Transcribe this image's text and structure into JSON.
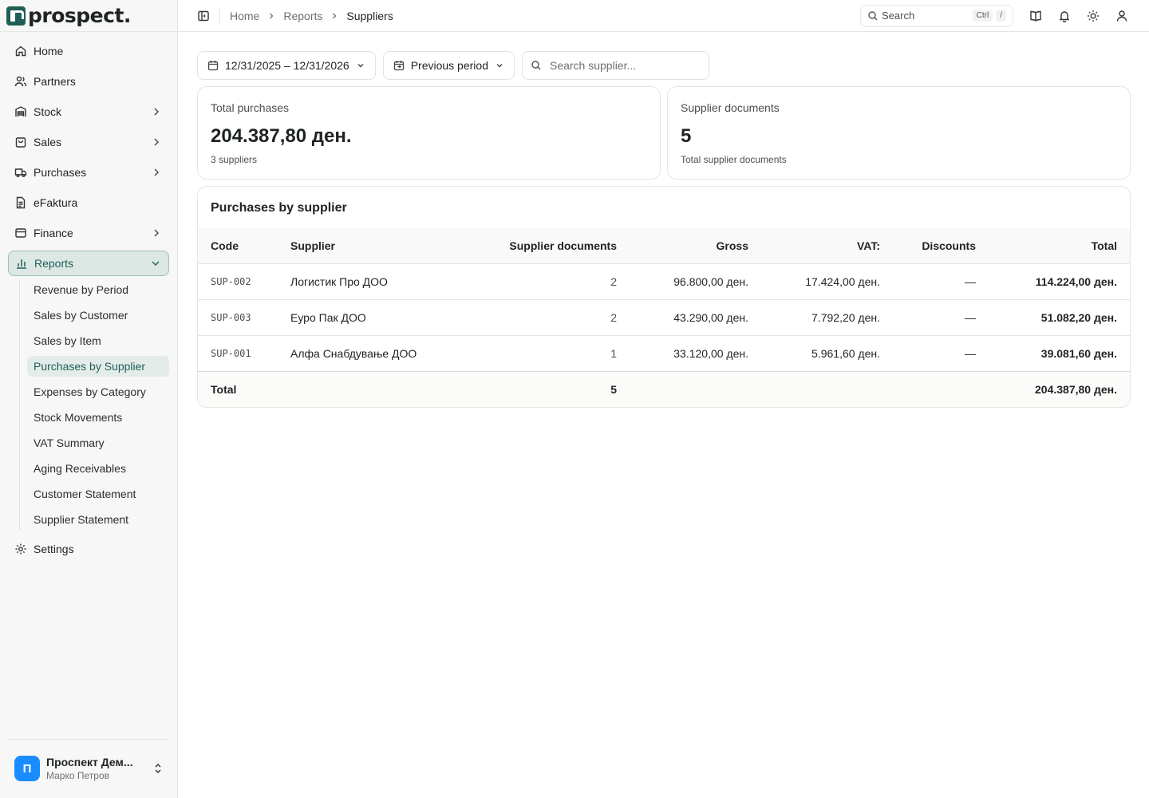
{
  "brand": {
    "name": "prospect."
  },
  "sidebar": {
    "items": [
      {
        "label": "Home",
        "icon": "home-icon"
      },
      {
        "label": "Partners",
        "icon": "users-icon"
      },
      {
        "label": "Stock",
        "icon": "warehouse-icon"
      },
      {
        "label": "Sales",
        "icon": "shopping-bag-icon"
      },
      {
        "label": "Purchases",
        "icon": "truck-icon"
      },
      {
        "label": "eFaktura",
        "icon": "document-icon"
      },
      {
        "label": "Finance",
        "icon": "wallet-icon"
      },
      {
        "label": "Reports",
        "icon": "bar-chart-icon"
      },
      {
        "label": "Settings",
        "icon": "gear-icon"
      }
    ],
    "reports_sub": [
      "Revenue by Period",
      "Sales by Customer",
      "Sales by Item",
      "Purchases by Supplier",
      "Expenses by Category",
      "Stock Movements",
      "VAT Summary",
      "Aging Receivables",
      "Customer Statement",
      "Supplier Statement"
    ],
    "user": {
      "initial": "П",
      "name": "Проспект Дем...",
      "subtitle": "Марко Петров"
    }
  },
  "header": {
    "breadcrumbs": [
      "Home",
      "Reports",
      "Suppliers"
    ],
    "search_label": "Search",
    "shortcut_ctrl": "Ctrl",
    "shortcut_key": "/"
  },
  "filters": {
    "date_range": "12/31/2025 – 12/31/2026",
    "compare": "Previous period",
    "search_placeholder": "Search supplier..."
  },
  "cards": {
    "total_purchases": {
      "label": "Total purchases",
      "value": "204.387,80 ден.",
      "sub": "3 suppliers"
    },
    "supplier_documents": {
      "label": "Supplier documents",
      "value": "5",
      "sub": "Total supplier documents"
    }
  },
  "table": {
    "title": "Purchases by supplier",
    "columns": [
      "Code",
      "Supplier",
      "Supplier documents",
      "Gross",
      "VAT:",
      "Discounts",
      "Total"
    ],
    "rows": [
      {
        "code": "SUP-002",
        "supplier": "Логистик Про ДОО",
        "docs": "2",
        "gross": "96.800,00 ден.",
        "vat": "17.424,00 ден.",
        "discounts": "—",
        "total": "114.224,00 ден."
      },
      {
        "code": "SUP-003",
        "supplier": "Еуро Пак ДОО",
        "docs": "2",
        "gross": "43.290,00 ден.",
        "vat": "7.792,20 ден.",
        "discounts": "—",
        "total": "51.082,20 ден."
      },
      {
        "code": "SUP-001",
        "supplier": "Алфа Снабдување ДОО",
        "docs": "1",
        "gross": "33.120,00 ден.",
        "vat": "5.961,60 ден.",
        "discounts": "—",
        "total": "39.081,60 ден."
      }
    ],
    "footer": {
      "label": "Total",
      "docs": "5",
      "total": "204.387,80 ден."
    }
  },
  "colors": {
    "accent": "#1e5f58",
    "avatar": "#1a8cff"
  }
}
